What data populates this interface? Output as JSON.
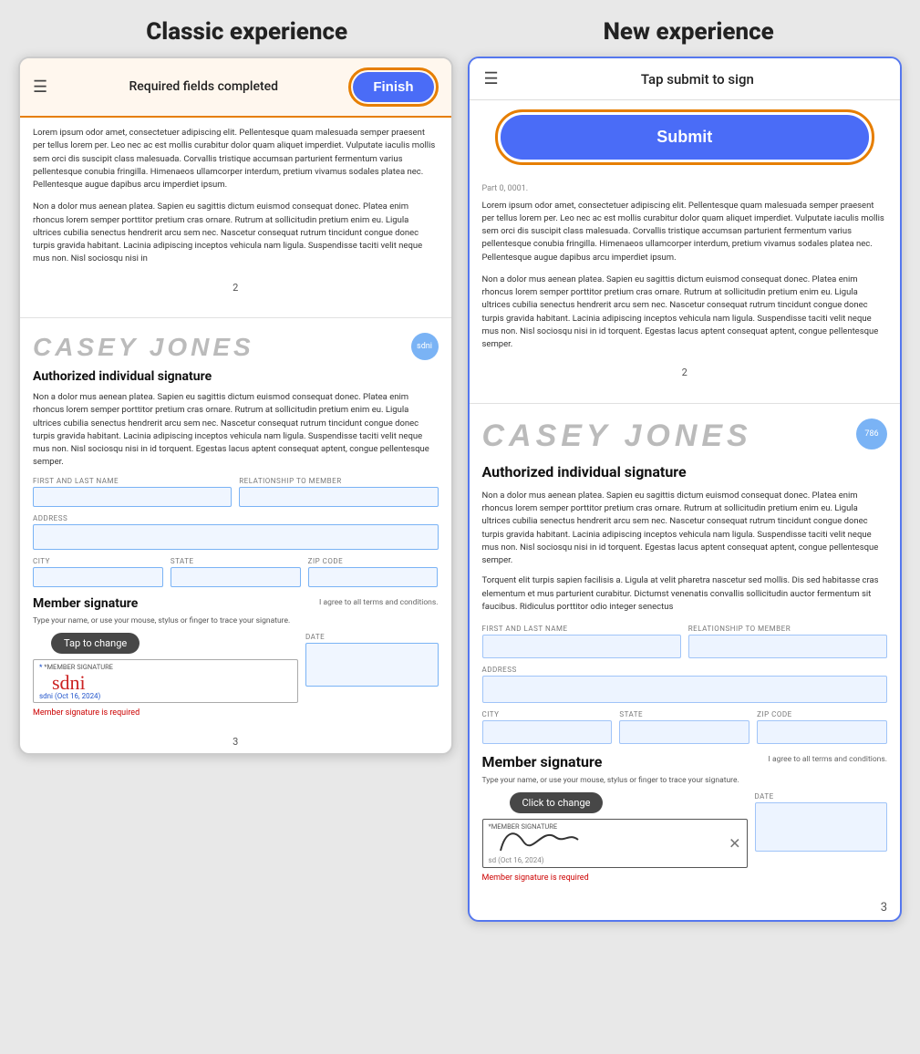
{
  "header": {
    "classic_title": "Classic experience",
    "new_title": "New experience"
  },
  "classic": {
    "nav": {
      "hamburger": "≡",
      "title": "Required fields\ncompleted",
      "finish_btn": "Finish"
    },
    "page1": {
      "lorem1": "Lorem ipsum odor amet, consectetuer adipiscing elit. Pellentesque quam malesuada semper praesent per tellus lorem per. Leo nec ac est mollis curabitur dolor quam aliquet imperdiet. Vulputate iaculis mollis sem orci dis suscipit class malesuada. Corvallis tristique accumsan parturient fermentum varius pellentesque conubia fringilla. Himenaeos ullamcorper interdum, pretium vivamus sodales platea nec. Pellentesque augue dapibus arcu imperdiet ipsum.",
      "lorem2": "Non a dolor mus aenean platea. Sapien eu sagittis dictum euismod consequat donec. Platea enim rhoncus lorem semper porttitor pretium cras ornare. Rutrum at sollicitudin pretium enim eu. Ligula ultrices cubilia senectus hendrerit arcu sem nec. Nascetur consequat rutrum tincidunt congue donec turpis gravida habitant. Lacinia adipiscing inceptos vehicula nam ligula. Suspendisse taciti velit neque mus non. Nisl sociosqu nisi in"
    },
    "page2_number": "2",
    "page3_number": "3",
    "signature_section": {
      "name": "CASEY JONES",
      "auth_sig_title": "Authorized individual signature",
      "body_text": "Non a dolor mus aenean platea. Sapien eu sagittis dictum euismod consequat donec. Platea enim rhoncus lorem semper porttitor pretium cras ornare. Rutrum at sollicitudin pretium enim eu. Ligula ultrices cubilia senectus hendrerit arcu sem nec. Nascetur consequat rutrum tincidunt congue donec turpis gravida habitant. Lacinia adipiscing inceptos vehicula nam ligula. Suspendisse taciti velit neque mus non. Nisl sociosqu nisi in id torquent. Egestas lacus aptent consequat aptent, congue pellentesque semper.",
      "fields": {
        "first_last_name": "FIRST AND LAST NAME",
        "relationship": "RELATIONSHIP TO MEMBER",
        "address": "ADDRESS",
        "city": "CITY",
        "state": "STATE",
        "zip": "ZIP CODE"
      }
    },
    "member_signature": {
      "title": "Member signature",
      "agree_text": "I agree to all terms and conditions.",
      "type_text": "Type your name, or use your mouse, stylus or finger to trace your signature.",
      "sig_label": "*MEMBER SIGNATURE",
      "date_label": "DATE",
      "sig_value": "sdni",
      "sig_date": "sdni  (Oct 16, 2024)",
      "error": "Member signature is required",
      "tap_tooltip": "Tap to change"
    }
  },
  "new": {
    "nav": {
      "hamburger": "≡",
      "title": "Tap submit to sign"
    },
    "submit_btn": "Submit",
    "page1": {
      "part_label": "Part 0, 0001.",
      "lorem1": "Lorem ipsum odor amet, consectetuer adipiscing elit. Pellentesque quam malesuada semper praesent per tellus lorem per. Leo nec ac est mollis curabitur dolor quam aliquet imperdiet. Vulputate iaculis mollis sem orci dis suscipit class malesuada. Corvallis tristique accumsan parturient fermentum varius pellentesque conubia fringilla. Himenaeos ullamcorper interdum, pretium vivamus sodales platea nec. Pellentesque augue dapibus arcu imperdiet ipsum.",
      "lorem2": "Non a dolor mus aenean platea. Sapien eu sagittis dictum euismod consequat donec. Platea enim rhoncus lorem semper porttitor pretium cras ornare. Rutrum at sollicitudin pretium enim eu. Ligula ultrices cubilia senectus hendrerit arcu sem nec. Nascetur consequat rutrum tincidunt congue donec turpis gravida habitant. Lacinia adipiscing inceptos vehicula nam ligula. Suspendisse taciti velit neque mus non. Nisl sociosqu nisi in id torquent. Egestas lacus aptent consequat aptent, congue pellentesque semper."
    },
    "page2_number": "2",
    "page3_number": "3",
    "signature_section": {
      "name": "CASEY JONES",
      "auth_sig_title": "Authorized individual signature",
      "body_text1": "Non a dolor mus aenean platea. Sapien eu sagittis dictum euismod consequat donec. Platea enim rhoncus lorem semper porttitor pretium cras ornare. Rutrum at sollicitudin pretium enim eu. Ligula ultrices cubilia senectus hendrerit arcu sem nec. Nascetur consequat rutrum tincidunt congue donec turpis gravida habitant. Lacinia adipiscing inceptos vehicula nam ligula. Suspendisse taciti velit neque mus non. Nisl sociosqu nisi in id torquent. Egestas lacus aptent consequat aptent, congue pellentesque semper.",
      "body_text2": "Torquent elit turpis sapien facilisis a. Ligula at velit pharetra nascetur sed mollis. Dis sed habitasse cras elementum et mus parturient curabitur. Dictumst venenatis convallis sollicitudin auctor fermentum sit faucibus. Ridiculus porttitor odio integer senectus",
      "fields": {
        "first_last_name": "FIRST AND LAST NAME",
        "relationship": "RELATIONSHIP TO MEMBER",
        "address": "ADDRESS",
        "city": "CITY",
        "state": "STATE",
        "zip": "ZIP CODE"
      }
    },
    "member_signature": {
      "title": "Member signature",
      "agree_text": "I agree to all terms and conditions.",
      "type_text": "Type your name, or use your mouse, stylus or finger to trace your signature.",
      "sig_label": "*MEMBER SIGNATURE",
      "date_label": "DATE",
      "sig_date": "sd (Oct 16, 2024)",
      "error": "Member signature is required",
      "click_tooltip": "Click to change"
    }
  },
  "icons": {
    "hamburger": "☰",
    "clear": "✕"
  }
}
